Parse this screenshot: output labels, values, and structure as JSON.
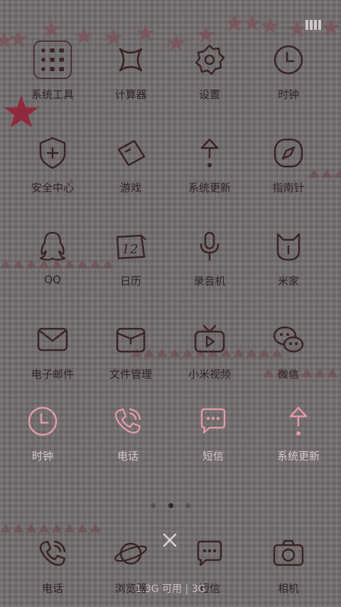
{
  "status": {
    "signal_icon": "signal-bars-icon"
  },
  "apps": [
    {
      "id": "system-tools",
      "label": "系统工具",
      "icon": "folder-icon"
    },
    {
      "id": "calculator",
      "label": "计算器",
      "icon": "calculator-icon"
    },
    {
      "id": "settings",
      "label": "设置",
      "icon": "gear-icon"
    },
    {
      "id": "clock",
      "label": "时钟",
      "icon": "clock-icon"
    },
    {
      "id": "security",
      "label": "安全中心",
      "icon": "shield-icon"
    },
    {
      "id": "games",
      "label": "游戏",
      "icon": "game-tag-icon"
    },
    {
      "id": "system-update",
      "label": "系统更新",
      "icon": "update-arrow-icon"
    },
    {
      "id": "compass",
      "label": "指南针",
      "icon": "compass-icon"
    },
    {
      "id": "qq",
      "label": "QQ",
      "icon": "penguin-icon"
    },
    {
      "id": "calendar",
      "label": "日历",
      "icon": "calendar-icon",
      "day": "12"
    },
    {
      "id": "recorder",
      "label": "录音机",
      "icon": "microphone-icon"
    },
    {
      "id": "mijia",
      "label": "米家",
      "icon": "mijia-icon"
    },
    {
      "id": "email",
      "label": "电子邮件",
      "icon": "envelope-icon"
    },
    {
      "id": "file-manager",
      "label": "文件管理",
      "icon": "briefcase-icon"
    },
    {
      "id": "mi-video",
      "label": "小米视频",
      "icon": "tv-icon"
    },
    {
      "id": "wechat",
      "label": "微信",
      "icon": "wechat-icon"
    }
  ],
  "pink_row": [
    {
      "id": "clock",
      "label": "时钟",
      "icon": "clock-icon"
    },
    {
      "id": "phone",
      "label": "电话",
      "icon": "phone-icon"
    },
    {
      "id": "sms",
      "label": "短信",
      "icon": "chat-bubble-icon"
    },
    {
      "id": "system-update",
      "label": "系统更新",
      "icon": "update-arrow-icon"
    }
  ],
  "dock": [
    {
      "id": "phone",
      "label": "电话",
      "icon": "phone-icon"
    },
    {
      "id": "browser",
      "label": "浏览器",
      "icon": "planet-icon"
    },
    {
      "id": "sms",
      "label": "短信",
      "icon": "chat-bubble-icon"
    },
    {
      "id": "camera",
      "label": "相机",
      "icon": "camera-icon"
    }
  ],
  "page_indicator": {
    "count": 3,
    "active_index": 1
  },
  "memory_text": "1.3G 可用 | 3G",
  "colors": {
    "icon_stroke": "#3a2326",
    "pink": "#e39aa8",
    "star": "#8a3a45"
  }
}
